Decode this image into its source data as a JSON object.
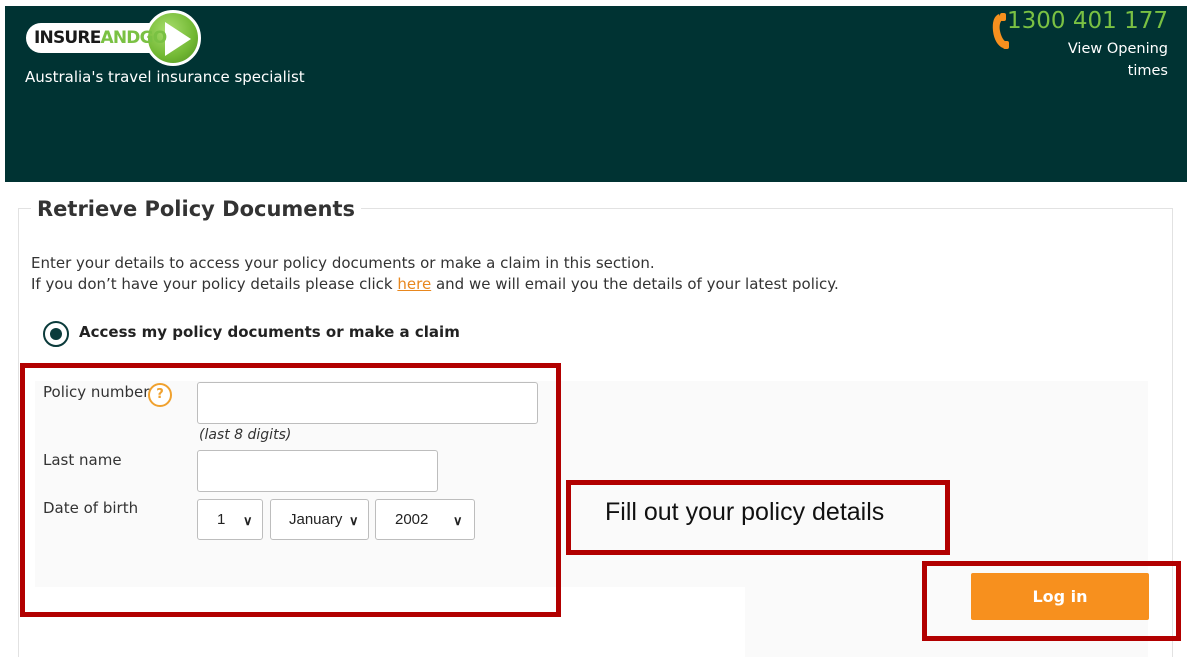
{
  "header": {
    "logo": {
      "insure": "INSURE",
      "and": "AND",
      "go": "GO"
    },
    "tagline": "Australia's travel insurance specialist",
    "phone_number": "1300 401 177",
    "opening_times_link": "View Opening times",
    "phone_icon": "phone-icon"
  },
  "panel": {
    "title": "Retrieve Policy Documents",
    "intro_line_1": "Enter your details to access your policy documents or make a claim in this section.",
    "intro_line_2_before": "If you don’t have your policy details please click ",
    "intro_line_2_link": "here",
    "intro_line_2_after": " and we will email you the details of your latest policy.",
    "radio_label": "Access my policy documents or make a claim"
  },
  "form": {
    "policy_number_label": "Policy number",
    "policy_number_value": "",
    "help_icon_glyph": "?",
    "policy_number_hint": "(last 8 digits)",
    "last_name_label": "Last name",
    "last_name_value": "",
    "dob_label": "Date of birth",
    "dob_day": "1",
    "dob_month": "January",
    "dob_year": "2002"
  },
  "annotation": {
    "callout_text": "Fill out your policy details"
  },
  "login_label": "Log in",
  "colors": {
    "header_bg": "#003333",
    "accent_green": "#7ac143",
    "accent_orange": "#f7901e",
    "annotation_red": "#b20000"
  }
}
